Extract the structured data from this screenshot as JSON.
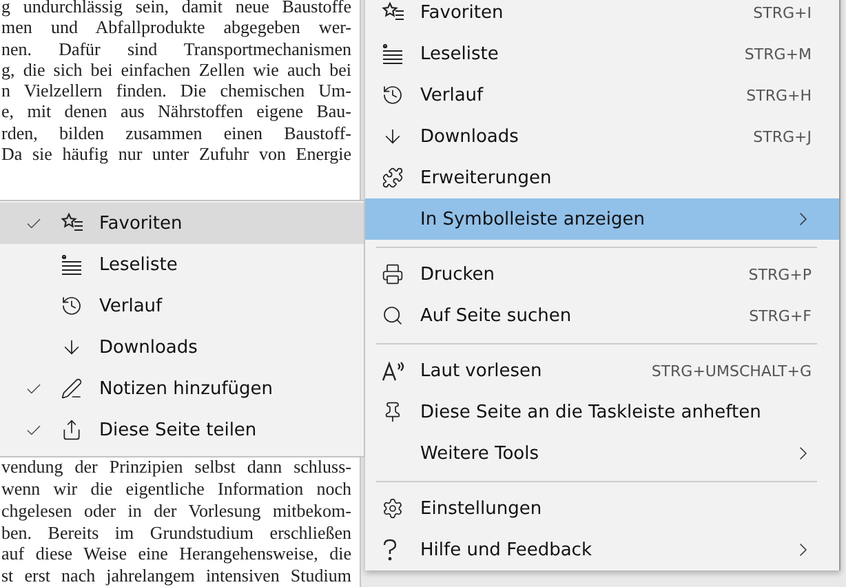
{
  "document": {
    "top_lines": [
      "g undurchlässig sein, damit neue Baustoffe",
      "men und Abfallprodukte abgegeben wer-",
      "nen. Dafür sind Transportmechanismen",
      "g, die sich bei einfachen Zellen wie auch bei",
      "n Vielzellern finden. Die chemischen Um-",
      "e, mit denen aus Nährstoffen eigene Bau-",
      "rden, bilden zusammen einen Baustoff-",
      "Da sie häufig nur unter Zufuhr von Energie"
    ],
    "bottom_lines": [
      "vendung der Prinzipien selbst dann schluss-",
      "wenn wir die eigentliche Information noch",
      "chgelesen oder in der Vorlesung mitbekom-",
      "ben. Bereits im Grundstudium erschließen",
      "auf diese Weise eine Herangehensweise, die",
      "st erst nach jahrelangem intensiven Studium"
    ]
  },
  "main_menu": {
    "items": [
      {
        "kind": "item",
        "label": "Favoriten",
        "shortcut": "STRG+I",
        "selected": false,
        "has_submenu": false
      },
      {
        "kind": "item",
        "label": "Leseliste",
        "shortcut": "STRG+M",
        "selected": false,
        "has_submenu": false
      },
      {
        "kind": "item",
        "label": "Verlauf",
        "shortcut": "STRG+H",
        "selected": false,
        "has_submenu": false
      },
      {
        "kind": "item",
        "label": "Downloads",
        "shortcut": "STRG+J",
        "selected": false,
        "has_submenu": false
      },
      {
        "kind": "item",
        "label": "Erweiterungen",
        "selected": false,
        "has_submenu": false
      },
      {
        "kind": "item",
        "label": "In Symbolleiste anzeigen",
        "selected": true,
        "has_submenu": true
      },
      {
        "kind": "separator"
      },
      {
        "kind": "item",
        "label": "Drucken",
        "shortcut": "STRG+P",
        "selected": false,
        "has_submenu": false
      },
      {
        "kind": "item",
        "label": "Auf Seite suchen",
        "shortcut": "STRG+F",
        "selected": false,
        "has_submenu": false
      },
      {
        "kind": "separator"
      },
      {
        "kind": "item",
        "label": "Laut vorlesen",
        "shortcut": "STRG+UMSCHALT+G",
        "selected": false,
        "has_submenu": false
      },
      {
        "kind": "item",
        "label": "Diese Seite an die Taskleiste anheften",
        "selected": false,
        "has_submenu": false
      },
      {
        "kind": "item",
        "label": "Weitere Tools",
        "selected": false,
        "has_submenu": true
      },
      {
        "kind": "separator"
      },
      {
        "kind": "item",
        "label": "Einstellungen",
        "selected": false,
        "has_submenu": false
      },
      {
        "kind": "item",
        "label": "Hilfe und Feedback",
        "selected": false,
        "has_submenu": true
      }
    ]
  },
  "submenu": {
    "items": [
      {
        "label": "Favoriten",
        "checked": true,
        "selected": true
      },
      {
        "label": "Leseliste",
        "checked": false,
        "selected": false
      },
      {
        "label": "Verlauf",
        "checked": false,
        "selected": false
      },
      {
        "label": "Downloads",
        "checked": false,
        "selected": false
      },
      {
        "label": "Notizen hinzufügen",
        "checked": true,
        "selected": false
      },
      {
        "label": "Diese Seite teilen",
        "checked": true,
        "selected": false
      }
    ]
  }
}
